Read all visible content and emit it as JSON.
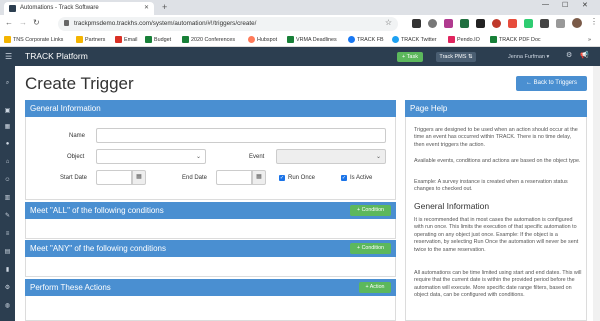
{
  "browser": {
    "tab_title": "Automations - Track Software",
    "new_tab": "+",
    "url": "trackpmsdemo.trackhs.com/system/automation/#!/triggers/create/",
    "bookmarks": [
      "TNS Corporate Links",
      "Partners",
      "Email",
      "Budget",
      "2020 Conferences",
      "Hubspot",
      "VRMA Deadlines",
      "TRACK FB",
      "TRACK Twitter",
      "Pendo.IO",
      "TRACK PDF Doc"
    ],
    "other_bookmarks": "»"
  },
  "topnav": {
    "brand": "TRACK Platform",
    "task_button": "+ Task",
    "product": "Track PMS",
    "user": "Jenna Furfman"
  },
  "page": {
    "title": "Create Trigger",
    "back_button": "← Back to Triggers"
  },
  "general": {
    "heading": "General Information",
    "name_label": "Name",
    "object_label": "Object",
    "event_label": "Event",
    "start_label": "Start Date",
    "end_label": "End Date",
    "run_once": "Run Once",
    "is_active": "Is Active"
  },
  "all_conditions": {
    "heading": "Meet \"ALL\" of the following conditions",
    "button": "+ Condition"
  },
  "any_conditions": {
    "heading": "Meet \"ANY\" of the following conditions",
    "button": "+ Condition"
  },
  "actions": {
    "heading": "Perform These Actions",
    "button": "+ Action"
  },
  "help": {
    "heading": "Page Help",
    "p1": "Triggers are designed to be used when an action should occur at the time an event has occurred within TRACK. There is no time delay, then event triggers the action.",
    "p2": "Available events, conditions and actions are based on the object type.",
    "p3": "Example: A survey instance is created when a reservation status changes to checked out.",
    "subheading": "General Information",
    "p4": "It is recommended that in most cases the automation is configured with run once. This limits the execution of that specific automation to operating on any object just once. Example: If the object is a reservation, by selecting Run Once the automation will never be sent twice to the same reservation.",
    "p5": "All automations can be time limited using start and end dates. This will require that the current date is within the provided period before the automation will execute. More specific date range filters, based on object data, can be configured with conditions."
  }
}
